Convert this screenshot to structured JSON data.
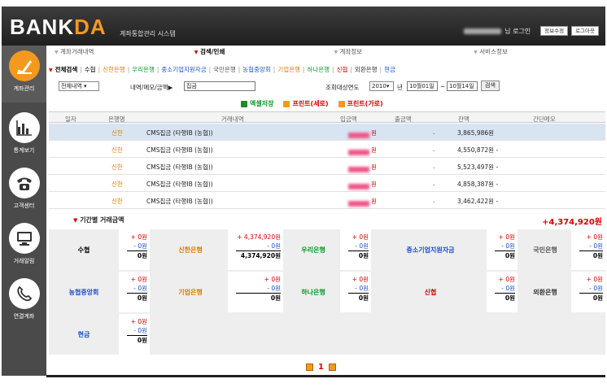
{
  "header": {
    "logo_a": "BANK",
    "logo_b": "DA",
    "system_title": "계좌통합관리 시스템",
    "login_suffix": "님 로그인",
    "btn_edit": "정보수정",
    "btn_logout": "로그아웃"
  },
  "sidebar": [
    {
      "label": "계좌관리",
      "icon": "pen-check-icon",
      "active": true
    },
    {
      "label": "통계보기",
      "icon": "bar-chart-icon",
      "active": false
    },
    {
      "label": "고객센터",
      "icon": "telephone-icon",
      "active": false
    },
    {
      "label": "거래알림",
      "icon": "monitor-icon",
      "active": false
    },
    {
      "label": "연결계좌",
      "icon": "phone-handset-icon",
      "active": false
    }
  ],
  "nav_tabs": [
    "계좌거래내역",
    "검색/인쇄",
    "계좌정보",
    "서비스정보"
  ],
  "bank_links": [
    {
      "label": "전체검색",
      "color": "#000000"
    },
    {
      "label": "수협",
      "color": "#000000"
    },
    {
      "label": "신한은행",
      "color": "#e07b00"
    },
    {
      "label": "우리은행",
      "color": "#0a9a2a"
    },
    {
      "label": "중소기업지원자금",
      "color": "#1a4fd0"
    },
    {
      "label": "국민은행",
      "color": "#555555"
    },
    {
      "label": "농협중앙회",
      "color": "#1a4fd0"
    },
    {
      "label": "기업은행",
      "color": "#e07b00"
    },
    {
      "label": "하나은행",
      "color": "#0a9a2a"
    },
    {
      "label": "신협",
      "color": "#d00000"
    },
    {
      "label": "외환은행",
      "color": "#333333"
    },
    {
      "label": "현금",
      "color": "#1a4fd0"
    }
  ],
  "search": {
    "type_value": "전체내역",
    "field_label": "내역/메모/금액▶",
    "query": "집금",
    "period_label": "조회대상연도",
    "year": "2010",
    "year_suffix": "년",
    "from": "10월01일",
    "to": "10월14일",
    "tilde": "~",
    "search_btn": "검색"
  },
  "actions": {
    "excel": "엑셀저장",
    "print_v": "프린트(세로)",
    "print_h": "프린트(가로)"
  },
  "table_headers": [
    "일자",
    "은행명",
    "거래내역",
    "입금액",
    "출금액",
    "잔액",
    "간단메모"
  ],
  "rows": [
    {
      "bank": "신한",
      "desc": "CMS집금 (타행IB (농협))",
      "won": "원",
      "out": ".",
      "balance": "3,865,986원",
      "selected": true,
      "memo": false
    },
    {
      "bank": "신한",
      "desc": "CMS집금 (타행IB (농협))",
      "won": "원",
      "out": ".",
      "balance": "4,550,872원 -",
      "selected": false,
      "memo": true
    },
    {
      "bank": "신한",
      "desc": "CMS집금 (타행IB (농협))",
      "won": "원",
      "out": ".",
      "balance": "5,523,497원 -",
      "selected": false,
      "memo": true
    },
    {
      "bank": "신한",
      "desc": "CMS집금 (타행IB (농협))",
      "won": "원",
      "out": ".",
      "balance": "4,858,387원 -",
      "selected": false,
      "memo": true
    },
    {
      "bank": "신한",
      "desc": "CMS집금 (타행IB (농협))",
      "won": "원",
      "out": ".",
      "balance": "3,462,422원 -",
      "selected": false,
      "memo": true
    }
  ],
  "summary": {
    "title": "기간별 거래금액",
    "total": "+4,374,920원",
    "banks": [
      {
        "name": "수협",
        "color": "#000000",
        "plus": "+ 0원",
        "minus": "- 0원",
        "net": "0원"
      },
      {
        "name": "신한은행",
        "color": "#e07b00",
        "plus": "+ 4,374,920원",
        "minus": "- 0원",
        "net": "4,374,920원"
      },
      {
        "name": "우리은행",
        "color": "#0a9a2a",
        "plus": "+ 0원",
        "minus": "- 0원",
        "net": "0원"
      },
      {
        "name": "중소기업지원자금",
        "color": "#1a4fd0",
        "plus": "+ 0원",
        "minus": "- 0원",
        "net": "0원"
      },
      {
        "name": "국민은행",
        "color": "#555555",
        "plus": "+ 0원",
        "minus": "- 0원",
        "net": "0원"
      },
      {
        "name": "농협중앙회",
        "color": "#1a4fd0",
        "plus": "+ 0원",
        "minus": "- 0원",
        "net": "0원"
      },
      {
        "name": "기업은행",
        "color": "#e07b00",
        "plus": "+ 0원",
        "minus": "- 0원",
        "net": "0원"
      },
      {
        "name": "하나은행",
        "color": "#0a9a2a",
        "plus": "+ 0원",
        "minus": "- 0원",
        "net": "0원"
      },
      {
        "name": "신협",
        "color": "#d00000",
        "plus": "+ 0원",
        "minus": "- 0원",
        "net": "0원"
      },
      {
        "name": "외환은행",
        "color": "#333333",
        "plus": "+ 0원",
        "minus": "- 0원",
        "net": "0원"
      },
      {
        "name": "현금",
        "color": "#1a4fd0",
        "plus": "+ 0원",
        "minus": "- 0원",
        "net": "0원"
      }
    ]
  },
  "pager": {
    "page": "1"
  },
  "colors": {
    "accent": "#f39a1e",
    "header_bg": "#2a2a2a",
    "sidebar_bg": "#4a4a4a",
    "total_red": "#d00000"
  }
}
